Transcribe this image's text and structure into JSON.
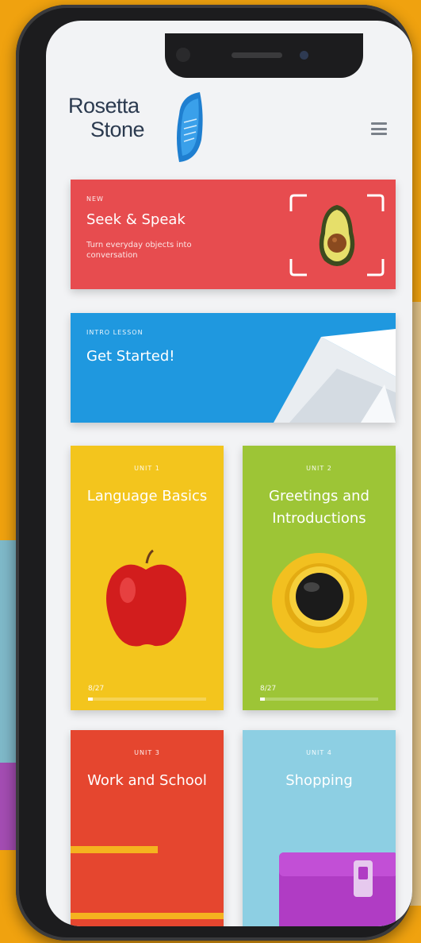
{
  "app": {
    "brand_line1": "Rosetta",
    "brand_line2": "Stone"
  },
  "colors": {
    "background": "#f0a20f",
    "seek_card": "#e74c4f",
    "intro_card": "#1f98df",
    "unit1": "#f3c51d",
    "unit2": "#9dc536",
    "unit3": "#e5462f",
    "unit4": "#8dcfe3"
  },
  "icons": {
    "menu": "hamburger-menu-icon",
    "logo": "rosetta-stone-logo-mark"
  },
  "feature_card": {
    "kicker": "NEW",
    "title": "Seek & Speak",
    "description": "Turn everyday objects into conversation"
  },
  "intro_card": {
    "kicker": "INTRO LESSON",
    "title": "Get Started!"
  },
  "units": [
    {
      "kicker": "UNIT 1",
      "title": "Language Basics",
      "progress_text": "8/27",
      "progress": 0.04
    },
    {
      "kicker": "UNIT 2",
      "title": "Greetings and Introductions",
      "progress_text": "8/27",
      "progress": 0.04
    },
    {
      "kicker": "UNIT 3",
      "title": "Work and School"
    },
    {
      "kicker": "UNIT 4",
      "title": "Shopping"
    }
  ]
}
